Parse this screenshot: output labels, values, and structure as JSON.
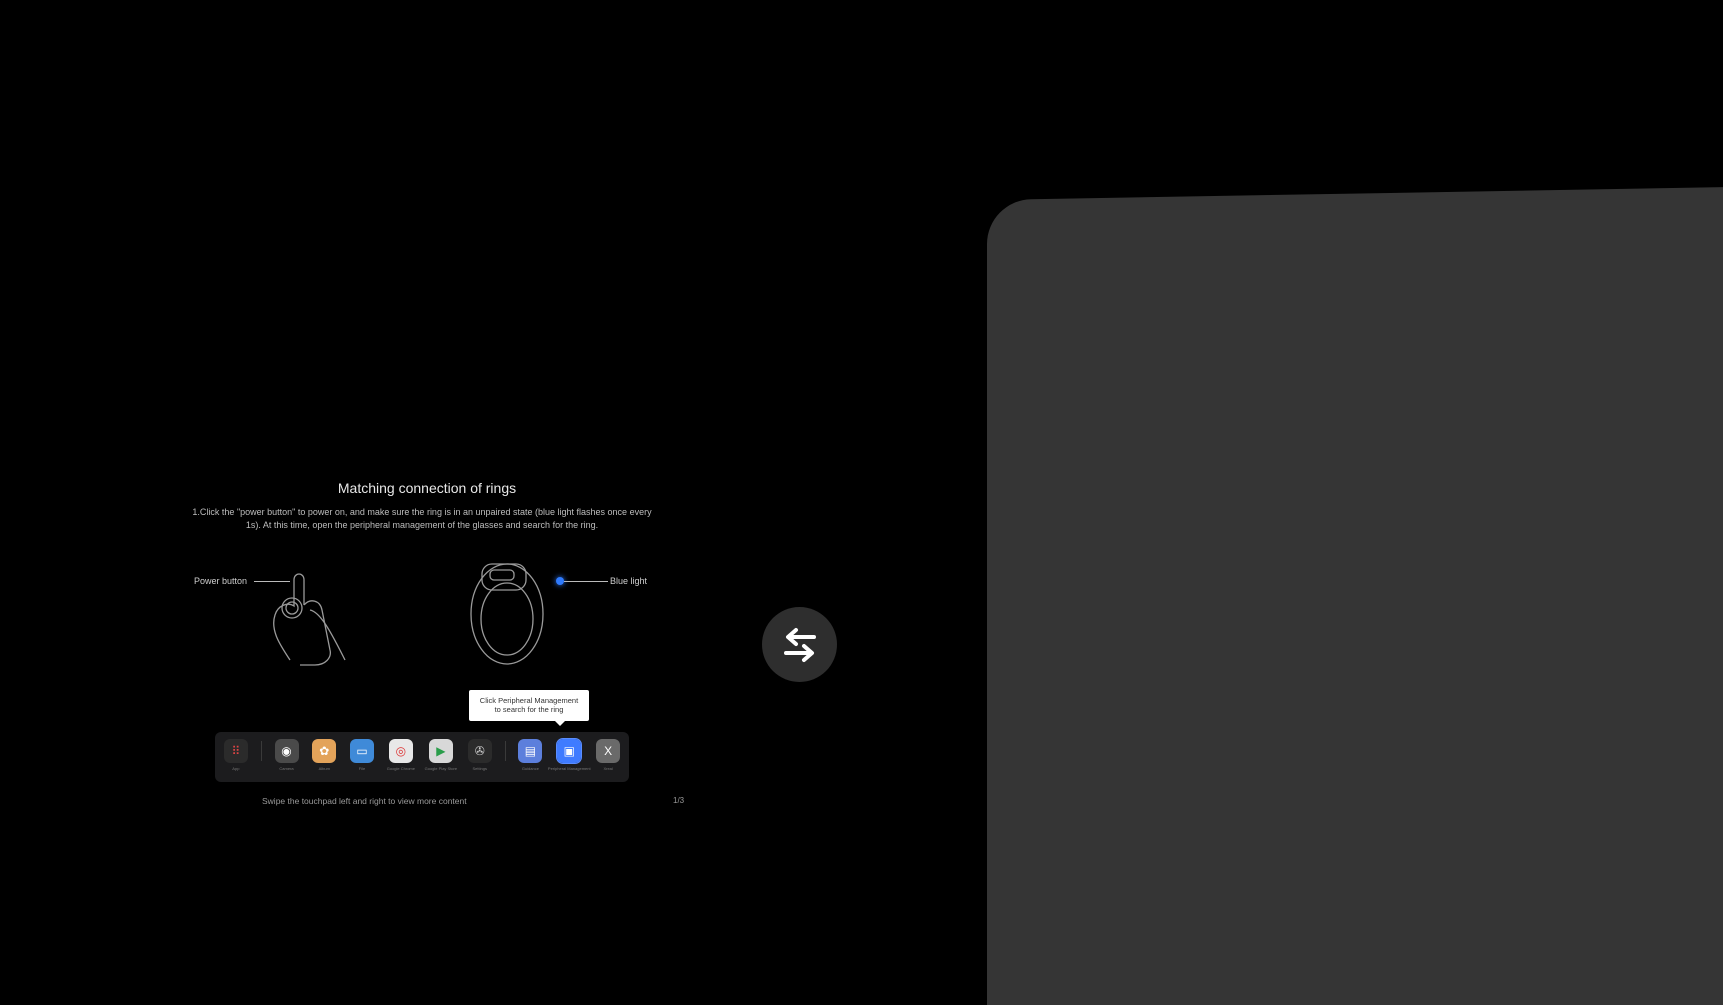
{
  "tutorial": {
    "title": "Matching connection of rings",
    "instruction_line1": "1.Click the \"power button\" to power on, and make sure the ring is in an unpaired state (blue light flashes once every",
    "instruction_line2": "1s). At this time, open the peripheral management of the glasses and search for the ring.",
    "power_button_label": "Power button",
    "blue_light_label": "Blue light",
    "tooltip_line1": "Click Peripheral Management",
    "tooltip_line2": "to search for the ring",
    "footer_hint": "Swipe the touchpad left and right to view more content",
    "page_indicator": "1/3"
  },
  "dock": {
    "items": [
      {
        "label": "App",
        "icon": "grid-icon",
        "color": "#2b2b2b",
        "glyph": "⠿"
      },
      {
        "label": "Camera",
        "icon": "camera-icon",
        "color": "#4a4a4a",
        "glyph": "◉"
      },
      {
        "label": "Album",
        "icon": "photos-icon",
        "color": "#e3a35a",
        "glyph": "✿"
      },
      {
        "label": "File",
        "icon": "folder-icon",
        "color": "#3f8ad8",
        "glyph": "▭"
      },
      {
        "label": "Google Chrome",
        "icon": "chrome-icon",
        "color": "#e8e8e8",
        "glyph": "◎"
      },
      {
        "label": "Google Play Store",
        "icon": "play-store-icon",
        "color": "#d8d8d8",
        "glyph": "▶"
      },
      {
        "label": "Settings",
        "icon": "settings-icon",
        "color": "#2b2b2b",
        "glyph": "✇"
      },
      {
        "label": "Guidance",
        "icon": "guidance-icon",
        "color": "#5c7fdc",
        "glyph": "▤"
      },
      {
        "label": "Peripheral Management",
        "icon": "peripheral-management-icon",
        "color": "#3f7bff",
        "glyph": "▣"
      },
      {
        "label": "Xreal",
        "icon": "xreal-icon",
        "color": "#6a6a6a",
        "glyph": "X"
      }
    ]
  },
  "colors": {
    "background": "#000000",
    "panel": "#353535",
    "switch_button": "#2e2e2e",
    "accent_blue": "#2f7bff"
  }
}
